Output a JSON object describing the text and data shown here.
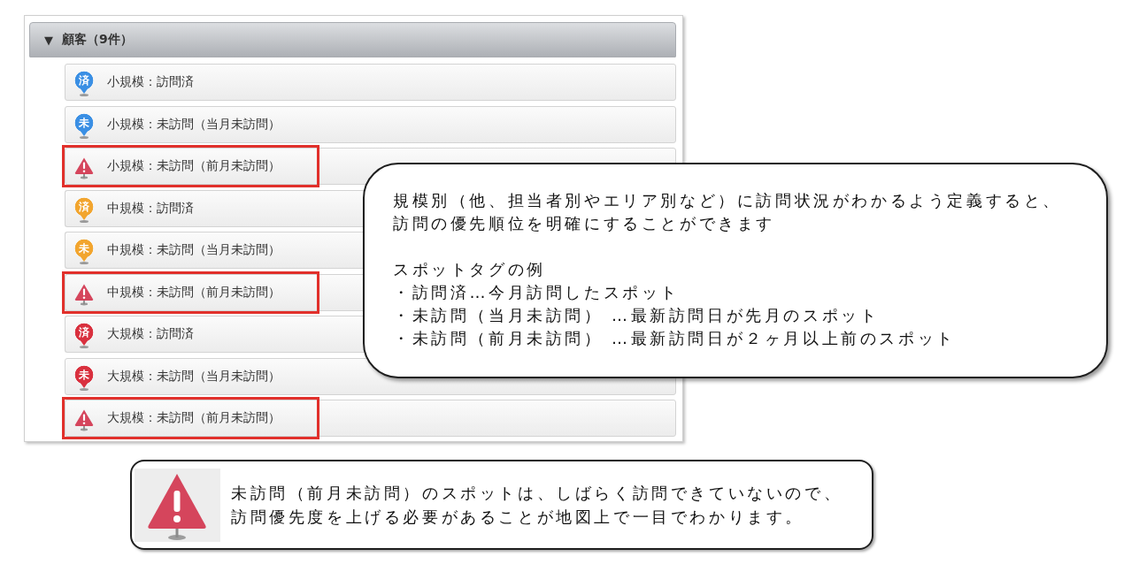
{
  "panel": {
    "header": {
      "arrow": "▼",
      "title": "顧客（9件）"
    },
    "items": [
      {
        "kind": "pin",
        "glyph": "済",
        "color": "#3a8fe4",
        "label": "小規模：訪問済",
        "highlighted": false
      },
      {
        "kind": "pin",
        "glyph": "未",
        "color": "#3a8fe4",
        "label": "小規模：未訪問（当月未訪問）",
        "highlighted": false
      },
      {
        "kind": "warning",
        "color": "#d5455c",
        "label": "小規模：未訪問（前月未訪問）",
        "highlighted": true
      },
      {
        "kind": "pin",
        "glyph": "済",
        "color": "#f2a52e",
        "label": "中規模：訪問済",
        "highlighted": false
      },
      {
        "kind": "pin",
        "glyph": "未",
        "color": "#f2a52e",
        "label": "中規模：未訪問（当月未訪問）",
        "highlighted": false
      },
      {
        "kind": "warning",
        "color": "#d5455c",
        "label": "中規模：未訪問（前月未訪問）",
        "highlighted": true
      },
      {
        "kind": "pin",
        "glyph": "済",
        "color": "#d9303e",
        "label": "大規模：訪問済",
        "highlighted": false
      },
      {
        "kind": "pin",
        "glyph": "未",
        "color": "#d9303e",
        "label": "大規模：未訪問（当月未訪問）",
        "highlighted": false
      },
      {
        "kind": "warning",
        "color": "#d5455c",
        "label": "大規模：未訪問（前月未訪問）",
        "highlighted": true
      }
    ]
  },
  "callout": {
    "intro": "規模別（他、担当者別やエリア別など）に訪問状況がわかるよう定義すると、訪問の優先順位を明確にすることができます",
    "list_title": "スポットタグの例",
    "examples": [
      "・訪問済…今月訪問したスポット",
      "・未訪問（当月未訪問） …最新訪問日が先月のスポット",
      "・未訪問（前月未訪問） …最新訪問日が２ヶ月以上前のスポット"
    ]
  },
  "note": {
    "text": "未訪問（前月未訪問）のスポットは、しばらく訪問できていないので、訪問優先度を上げる必要があることが地図上で一目でわかります。"
  }
}
